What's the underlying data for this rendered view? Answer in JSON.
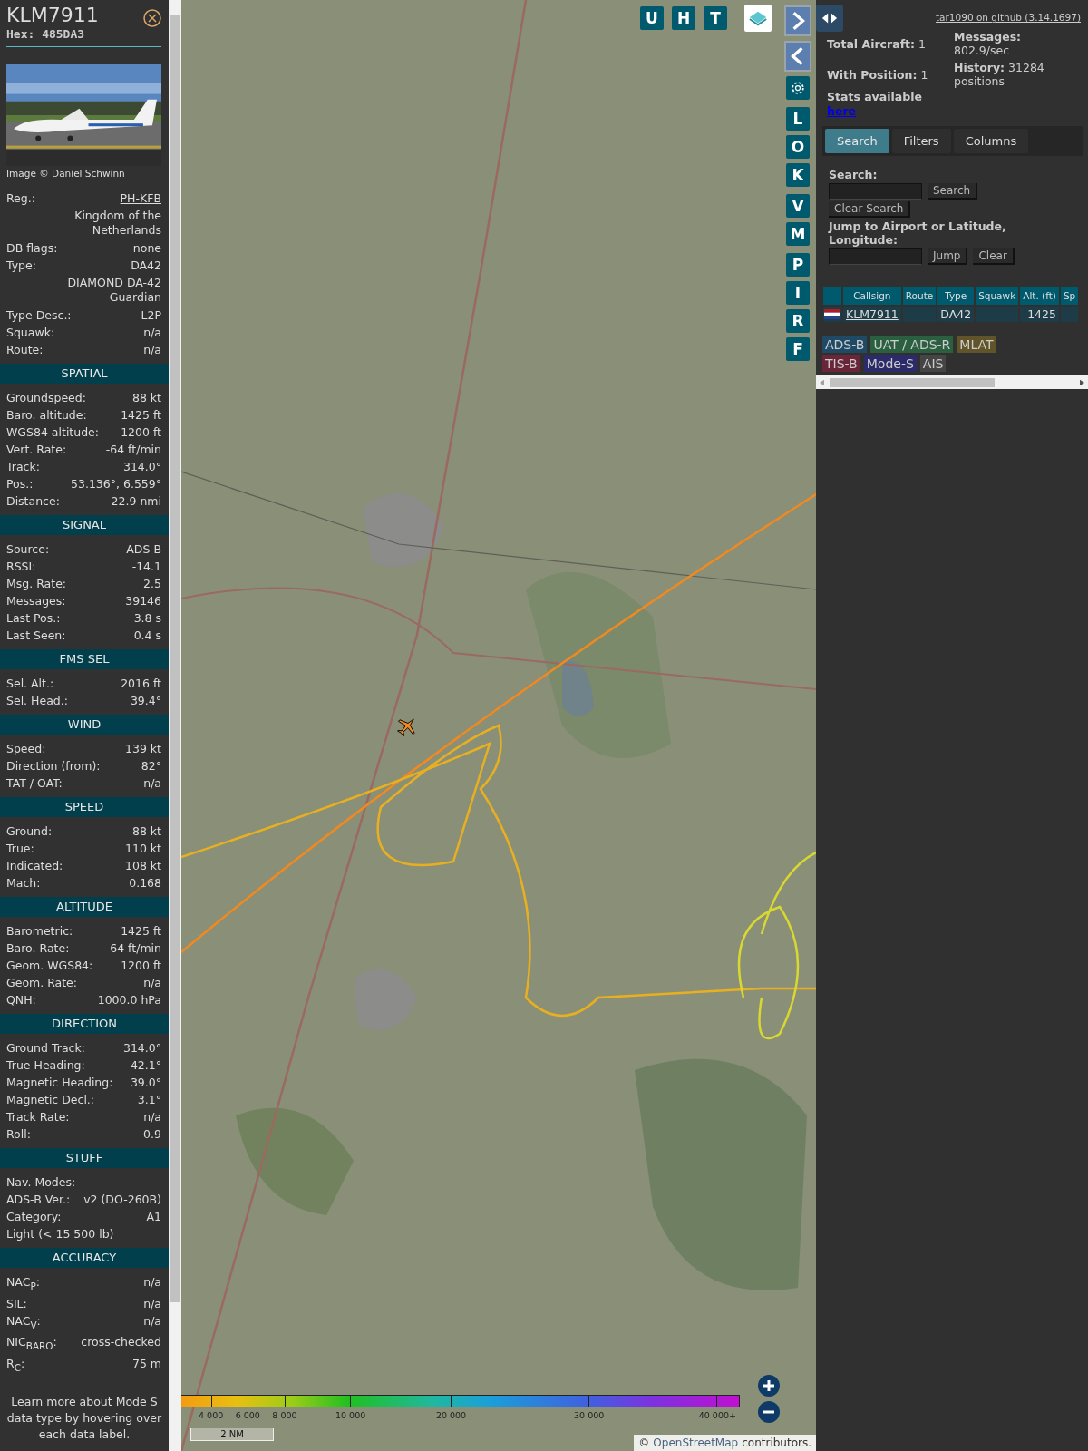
{
  "aircraft": {
    "callsign": "KLM7911",
    "hex": "Hex: 485DA3",
    "photo_credit": "Image © Daniel Schwinn"
  },
  "info_rows": [
    {
      "kind": "link",
      "label": "Reg.:",
      "value": "PH-KFB"
    },
    {
      "kind": "note",
      "value": "Kingdom of the Netherlands"
    },
    {
      "kind": "pair",
      "label": "DB flags:",
      "value": "none"
    },
    {
      "kind": "pair",
      "label": "Type:",
      "value": "DA42"
    },
    {
      "kind": "note",
      "value": "DIAMOND DA-42 Guardian"
    },
    {
      "kind": "pair",
      "label": "Type Desc.:",
      "value": "L2P"
    },
    {
      "kind": "pair",
      "label": "Squawk:",
      "value": "n/a"
    },
    {
      "kind": "pair",
      "label": "Route:",
      "value": "n/a"
    }
  ],
  "sections": [
    {
      "title": "SPATIAL",
      "rows": [
        {
          "label": "Groundspeed:",
          "value": "88 kt"
        },
        {
          "label": "Baro. altitude:",
          "value": "1425 ft"
        },
        {
          "label": "WGS84 altitude:",
          "value": "1200 ft"
        },
        {
          "label": "Vert. Rate:",
          "value": "-64 ft/min"
        },
        {
          "label": "Track:",
          "value": "314.0°"
        },
        {
          "label": "Pos.:",
          "value": "53.136°, 6.559°"
        },
        {
          "label": "Distance:",
          "value": "22.9 nmi"
        }
      ]
    },
    {
      "title": "SIGNAL",
      "rows": [
        {
          "label": "Source:",
          "value": "ADS-B"
        },
        {
          "label": "RSSI:",
          "value": "-14.1"
        },
        {
          "label": "Msg. Rate:",
          "value": "2.5"
        },
        {
          "label": "Messages:",
          "value": "39146"
        },
        {
          "label": "Last Pos.:",
          "value": "3.8 s"
        },
        {
          "label": "Last Seen:",
          "value": "0.4 s"
        }
      ]
    },
    {
      "title": "FMS SEL",
      "rows": [
        {
          "label": "Sel. Alt.:",
          "value": "2016 ft"
        },
        {
          "label": "Sel. Head.:",
          "value": "39.4°"
        }
      ]
    },
    {
      "title": "WIND",
      "rows": [
        {
          "label": "Speed:",
          "value": "139 kt"
        },
        {
          "label": "Direction (from):",
          "value": "82°"
        },
        {
          "label": "TAT / OAT:",
          "value": "n/a"
        }
      ]
    },
    {
      "title": "SPEED",
      "rows": [
        {
          "label": "Ground:",
          "value": "88 kt"
        },
        {
          "label": "True:",
          "value": "110 kt"
        },
        {
          "label": "Indicated:",
          "value": "108 kt"
        },
        {
          "label": "Mach:",
          "value": "0.168"
        }
      ]
    },
    {
      "title": "ALTITUDE",
      "rows": [
        {
          "label": "Barometric:",
          "value": "1425 ft"
        },
        {
          "label": "Baro. Rate:",
          "value": "-64 ft/min"
        },
        {
          "label": "Geom. WGS84:",
          "value": "1200 ft"
        },
        {
          "label": "Geom. Rate:",
          "value": "n/a"
        },
        {
          "label": "QNH:",
          "value": "1000.0 hPa"
        }
      ]
    },
    {
      "title": "DIRECTION",
      "rows": [
        {
          "label": "Ground Track:",
          "value": "314.0°"
        },
        {
          "label": "True Heading:",
          "value": "42.1°"
        },
        {
          "label": "Magnetic Heading:",
          "value": "39.0°"
        },
        {
          "label": "Magnetic Decl.:",
          "value": "3.1°"
        },
        {
          "label": "Track Rate:",
          "value": "n/a"
        },
        {
          "label": "Roll:",
          "value": "0.9"
        }
      ]
    },
    {
      "title": "STUFF",
      "rows": [
        {
          "label": "Nav. Modes:"
        },
        {
          "label": "ADS-B Ver.:",
          "value": "v2 (DO-260B)"
        },
        {
          "label": "Category:",
          "value": "A1"
        },
        {
          "label": "Light (< 15 500 lb)"
        }
      ]
    },
    {
      "title": "ACCURACY",
      "rows": [
        {
          "label": "NAC$_{P}$:",
          "value": "n/a"
        },
        {
          "label": "SIL:",
          "value": "n/a"
        },
        {
          "label": "NAC$_{V}$:",
          "value": "n/a"
        },
        {
          "label": "NIC$_{BARO}$:",
          "value": "cross-checked"
        },
        {
          "label": "R$_{C}$:",
          "value": "75 m"
        }
      ]
    }
  ],
  "footer_note": "Learn more about Mode S data type by hovering over each data label.",
  "map": {
    "top_buttons": [
      "U",
      "H",
      "T"
    ],
    "side_button_groups": [
      [
        "L",
        "O",
        "K"
      ],
      [
        "V",
        "M"
      ],
      [
        "P",
        "I",
        "R",
        "F"
      ]
    ],
    "legend_labels": [
      "4 000",
      "6 000",
      "8 000",
      "10 000",
      "20 000",
      "30 000",
      "40 000+"
    ],
    "scale": "2 NM",
    "attribution_prefix": "©",
    "attribution_link": "OpenStreetMap",
    "attribution_suffix": "contributors."
  },
  "panel": {
    "version_link": "tar1090 on github (3.14.1697)",
    "stats": [
      "**Total Aircraft:** 1",
      "**With Position:** 1",
      "**Messages:** 802.9/sec",
      "**History:** 31284 positions"
    ],
    "stats_note": "Stats available",
    "stats_link": "here",
    "tabs": [
      {
        "label": "Search",
        "selected": true
      },
      {
        "label": "Filters",
        "selected": false
      },
      {
        "label": "Columns",
        "selected": false
      }
    ],
    "search_label": "Search:",
    "search_button": "Search",
    "clear_search_button": "Clear Search",
    "jump_label": "Jump to Airport or Latitude, Longitude:",
    "jump_button": "Jump",
    "clear_button": "Clear",
    "table": {
      "columns": [
        "Callsign",
        "Route",
        "Type",
        "Squawk",
        "Alt. (ft)",
        "Sp"
      ],
      "rows": [
        {
          "callsign": "KLM7911",
          "route": "",
          "type": "DA42",
          "squawk": "",
          "altitude": "1425"
        }
      ]
    },
    "sources": [
      {
        "label": "ADS-B",
        "color": "#1f4a66"
      },
      {
        "label": "UAT / ADS-R",
        "color": "#2a6040"
      },
      {
        "label": "MLAT",
        "color": "#615428"
      },
      {
        "label": "TIS-B",
        "color": "#6a2538"
      },
      {
        "label": "Mode-S",
        "color": "#2b2a6a"
      },
      {
        "label": "AIS",
        "color": "#454545"
      }
    ]
  }
}
